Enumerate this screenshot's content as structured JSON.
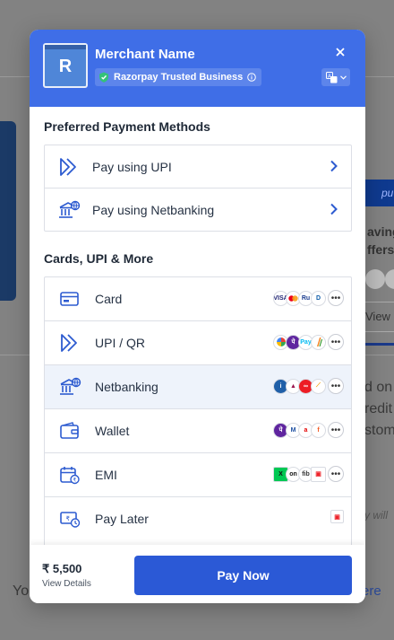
{
  "background": {
    "tab_text": "pu",
    "saving_line1": "aving",
    "saving_line2": "ffers",
    "view_label": "View",
    "side_text1": "d on",
    "side_text2": "redit",
    "side_text3": "stom",
    "side_text4": "y will",
    "bottom_left": "Yo",
    "bottom_link": "ere"
  },
  "header": {
    "logo_letter": "R",
    "merchant_name": "Merchant Name",
    "trusted_label": "Razorpay Trusted Business",
    "brand_color": "#3f6ee7"
  },
  "preferred": {
    "title": "Preferred Payment Methods",
    "items": [
      {
        "label": "Pay using UPI",
        "icon": "upi-icon"
      },
      {
        "label": "Pay using Netbanking",
        "icon": "bank-icon"
      }
    ]
  },
  "more": {
    "title": "Cards, UPI & More",
    "items": [
      {
        "label": "Card",
        "icon": "card-icon",
        "badges": [
          "VISA",
          "MC",
          "RuPay",
          "Diners"
        ]
      },
      {
        "label": "UPI / QR",
        "icon": "upi-icon",
        "badges": [
          "GPay",
          "PhonePe",
          "Paytm",
          "BHIM"
        ]
      },
      {
        "label": "Netbanking",
        "icon": "bank-icon",
        "badges": [
          "ICICI",
          "Axis",
          "Kotak",
          "SBI"
        ]
      },
      {
        "label": "Wallet",
        "icon": "wallet-icon",
        "badges": [
          "PhonePe",
          "Mobikwik",
          "Airtel",
          "Freecharge"
        ]
      },
      {
        "label": "EMI",
        "icon": "emi-icon",
        "badges": [
          "Zest",
          "ePayLater",
          "Flexi",
          "HDFC"
        ]
      },
      {
        "label": "Pay Later",
        "icon": "paylater-icon",
        "badges": [
          "HDFC"
        ]
      }
    ]
  },
  "footer": {
    "amount": "₹ 5,500",
    "details_label": "View Details",
    "pay_label": "Pay Now"
  }
}
